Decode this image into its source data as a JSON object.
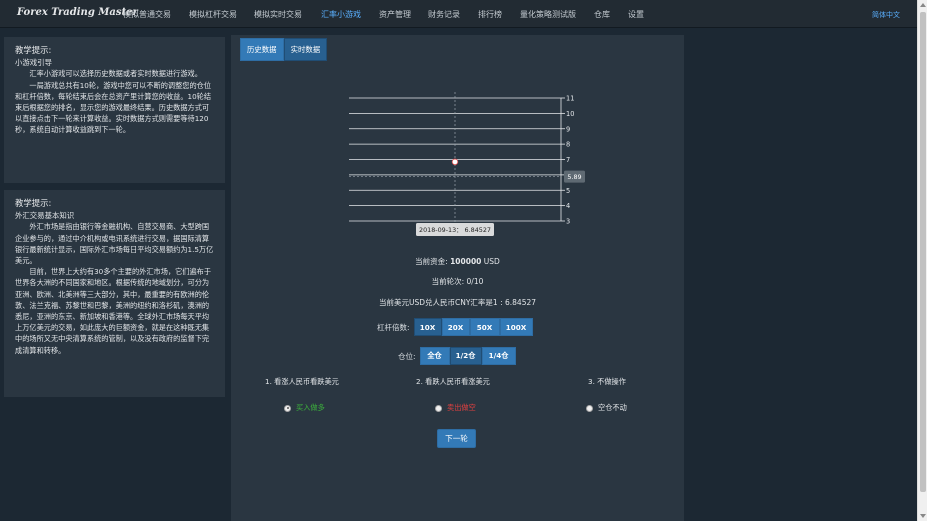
{
  "nav": {
    "brand": "Forex Trading Master",
    "items": [
      "模拟普通交易",
      "模拟杠杆交易",
      "模拟实时交易",
      "汇率小游戏",
      "资产管理",
      "财务记录",
      "排行榜",
      "量化策略测试版",
      "仓库",
      "设置"
    ],
    "active_index": 3,
    "lang": "简体中文"
  },
  "panel1": {
    "title": "教学提示:",
    "subtitle": "小游戏引导",
    "paragraphs": [
      "汇率小游戏可以选择历史数据或者实时数据进行游戏。",
      "一局游戏总共有10轮，游戏中您可以不断的调整您的仓位和杠杆倍数，每轮结束后会在总资产里计算您的收益。10轮结束后根据您的排名，显示您的游戏最终结果。历史数据方式可以直接点击下一轮来计算收益。实时数据方式则需要等待120秒，系统自动计算收益跳到下一轮。"
    ]
  },
  "panel2": {
    "title": "教学提示:",
    "subtitle": "外汇交易基本知识",
    "paragraphs": [
      "外汇市场是指由银行等金融机构、自营交易商、大型跨国企业参与的，通过中介机构或电讯系统进行交易，据国际清算银行最新统计显示，国际外汇市场每日平均交易额约为1.5万亿美元。",
      "目前，世界上大约有30多个主要的外汇市场，它们遍布于世界各大洲的不同国家和地区。根据传统的地域划分，可分为亚洲、欧洲、北美洲等三大部分，其中，最重要的有欧洲的伦敦、法兰克福、苏黎世和巴黎，美洲的纽约和洛杉矶，澳洲的悉尼，亚洲的东京、新加坡和香港等。全球外汇市场每天平均上万亿美元的交易，如此庞大的巨额资金，就是在这种既无集中的场所又无中央清算系统的管制，以及没有政府的监督下完成清算和转移。"
    ]
  },
  "tabs": [
    "历史数据",
    "实时数据"
  ],
  "active_tab": 1,
  "chart_data": {
    "type": "line",
    "x": [
      "2018-09-13"
    ],
    "series": [
      {
        "values": [
          6.84527
        ]
      }
    ],
    "ylim": [
      3,
      11
    ],
    "yticks": [
      3,
      4,
      5,
      6,
      7,
      8,
      9,
      10,
      11
    ],
    "y_axis_position": "right",
    "crosshair_y_label": "5.89",
    "tooltip": "2018-09-13： 6.84527",
    "grid": true
  },
  "info": {
    "assets_label": "当前资金: ",
    "assets_value": "100000",
    "assets_unit": " USD",
    "round_label": "当前轮次: 0/10",
    "rate_label": "当前美元USD兑人民币CNY汇率是1 : 6.84527"
  },
  "leverage": {
    "label": "杠杆倍数:",
    "options": [
      "10X",
      "20X",
      "50X",
      "100X"
    ],
    "active_index": 0
  },
  "position": {
    "label": "仓位:",
    "options": [
      "全仓",
      "1/2仓",
      "1/4仓"
    ],
    "active_index": 1
  },
  "choices": [
    {
      "label": "1. 看涨人民币看跌美元",
      "action": "买入做多",
      "color": "#3cb03c",
      "checked": true
    },
    {
      "label": "2. 看跌人民币看涨美元",
      "action": "卖出做空",
      "color": "#e04040",
      "checked": false
    },
    {
      "label": "3. 不做操作",
      "action": "空仓不动",
      "color": "#e3e6e9",
      "checked": false
    }
  ],
  "next_button": "下一轮"
}
